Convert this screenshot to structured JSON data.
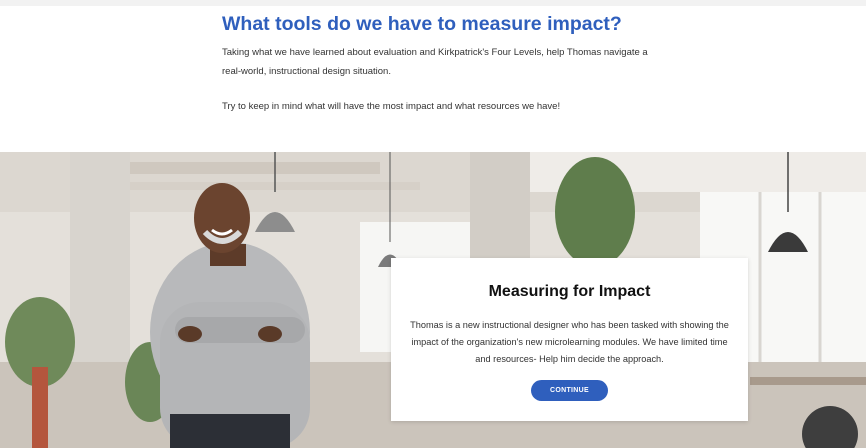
{
  "heading": "What tools do we have to measure impact?",
  "intro": "Taking what we have learned about evaluation and Kirkpatrick's Four Levels, help Thomas navigate a real-world, instructional design situation.",
  "tip": "Try to keep in mind what will have the most impact and what resources we have!",
  "card": {
    "title": "Measuring for Impact",
    "body": "Thomas is a new instructional designer who has been tasked with showing the impact of the organization's new microlearning modules. We have limited time and resources- Help him decide the approach.",
    "button_label": "CONTINUE"
  },
  "colors": {
    "accent": "#2f5fbd",
    "heading": "#2f5fbd"
  },
  "image": {
    "description_icon": "office-background-photo"
  }
}
